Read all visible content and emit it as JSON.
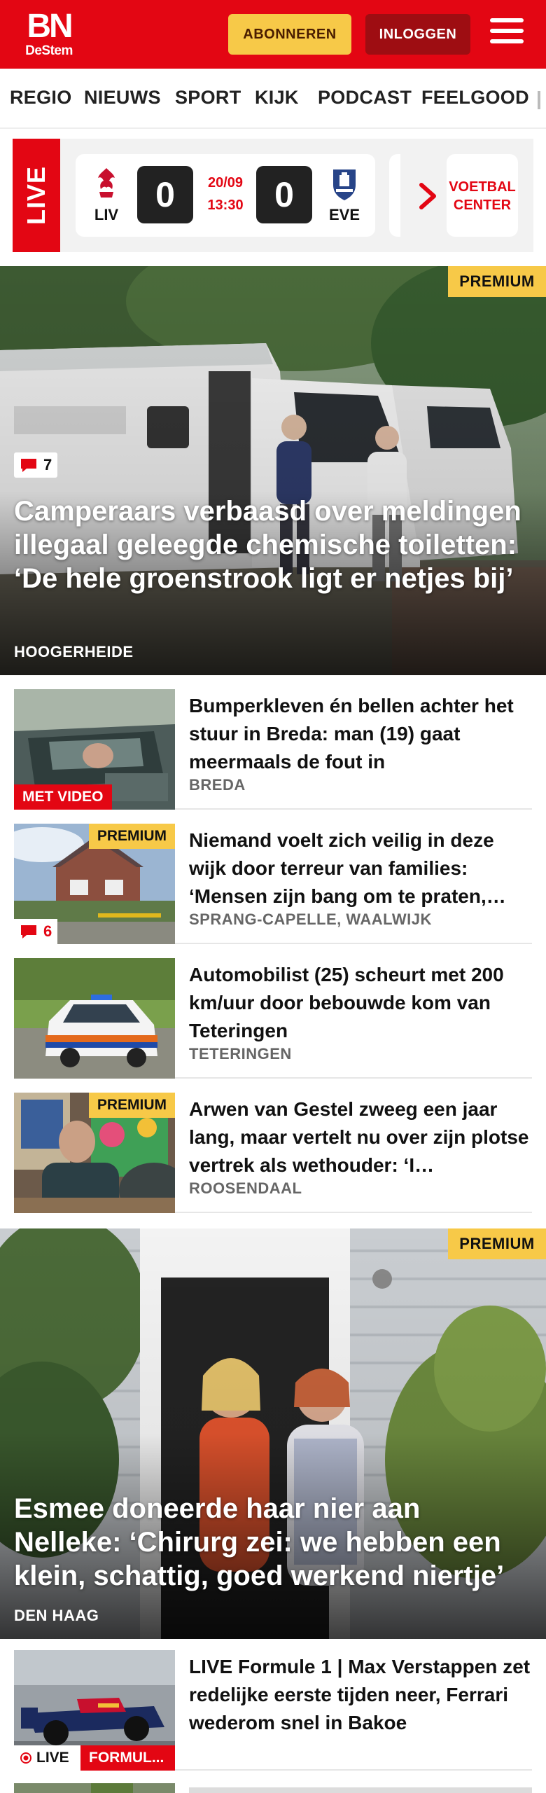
{
  "header": {
    "logo_main": "BN",
    "logo_sub": "DeStem",
    "subscribe_label": "ABONNEREN",
    "login_label": "INLOGGEN"
  },
  "nav": [
    "REGIO",
    "NIEUWS",
    "SPORT",
    "KIJK",
    "PODCAST",
    "FEELGOOD"
  ],
  "live": {
    "label": "LIVE",
    "match": {
      "home_code": "LIV",
      "away_code": "EVE",
      "home_score": "0",
      "away_score": "0",
      "date": "20/09",
      "time": "13:30"
    },
    "voetbal_label_1": "VOETBAL",
    "voetbal_label_2": "CENTER"
  },
  "hero1": {
    "premium": "PREMIUM",
    "comments": "7",
    "title": "Camperaars verbaasd over meldingen illegaal geleegde chemische toiletten: ‘De hele groenstrook ligt er netjes bij’",
    "location": "HOOGERHEIDE"
  },
  "articles": [
    {
      "title": "Bumperkleven én bellen achter het stuur in Breda: man (19) gaat meermaals de fout in",
      "location": "BREDA",
      "tag": "MET VIDEO"
    },
    {
      "title": "Niemand voelt zich veilig in deze wijk door terreur van families: ‘Mensen zijn bang om te praten,…",
      "location": "SPRANG-CAPELLE, WAALWIJK",
      "premium": "PREMIUM",
      "comments": "6"
    },
    {
      "title": "Automobilist (25) scheurt met 200 km/uur door bebouwde kom van Teteringen",
      "location": "TETERINGEN"
    },
    {
      "title": "Arwen van Gestel zweeg een jaar lang, maar vertelt nu over zijn plotse vertrek als wethouder: ‘I…",
      "location": "ROOSENDAAL",
      "premium": "PREMIUM"
    }
  ],
  "hero2": {
    "premium": "PREMIUM",
    "title": "Esmee doneerde haar nier aan Nelleke: ‘Chirurg zei: we hebben een klein, schattig, goed werkend niertje’",
    "location": "DEN HAAG"
  },
  "article_f1": {
    "title": "LIVE Formule 1 | Max Verstappen zet redelijke eerste tijden neer, Ferrari wederom snel in Bakoe",
    "live_tag": "LIVE",
    "category_tag": "FORMUL..."
  },
  "colors": {
    "brand_red": "#e30613",
    "premium_yellow": "#f7c948",
    "dark_red": "#9e0d12"
  }
}
